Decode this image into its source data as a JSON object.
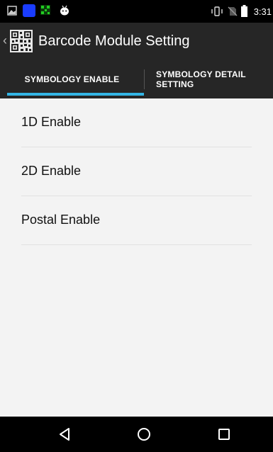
{
  "status_bar": {
    "time": "3:31",
    "icons": [
      "gallery-icon",
      "blue-app-icon",
      "qr-app-icon",
      "android-icon",
      "vibrate-icon",
      "no-sim-icon",
      "battery-icon"
    ],
    "colors": {
      "blue_app": "#1a3cff",
      "qr_app": "#19a319"
    }
  },
  "app_bar": {
    "title": "Barcode Module Setting",
    "back_icon": "chevron-left-icon",
    "logo_icon": "qr-code-icon"
  },
  "tabs": [
    {
      "label": "SYMBOLOGY ENABLE",
      "selected": true
    },
    {
      "label": "SYMBOLOGY DETAIL SETTING",
      "selected": false
    }
  ],
  "list": {
    "items": [
      {
        "label": "1D Enable"
      },
      {
        "label": "2D Enable"
      },
      {
        "label": "Postal Enable"
      }
    ]
  },
  "nav_bar": {
    "buttons": [
      "back-triangle-icon",
      "home-circle-icon",
      "recents-square-icon"
    ]
  },
  "colors": {
    "accent": "#33b5e5",
    "app_bar": "#262626",
    "background": "#f3f3f3"
  }
}
